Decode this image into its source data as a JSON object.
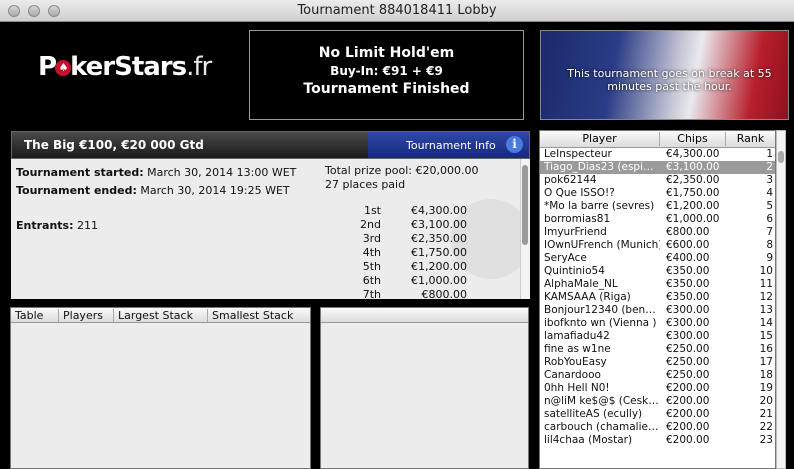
{
  "window": {
    "title": "Tournament 884018411 Lobby"
  },
  "logo": {
    "text_a": "P",
    "text_b": "kerStars",
    "text_c": ".fr"
  },
  "info": {
    "game": "No Limit Hold'em",
    "buyin": "Buy-In: €91 + €9",
    "status": "Tournament Finished"
  },
  "banner": {
    "message": "This tournament goes on break at 55 minutes past the hour."
  },
  "header": {
    "tournament_name": "The Big €100, €20 000 Gtd",
    "tab_label": "Tournament Info",
    "info_glyph": "i"
  },
  "details": {
    "started_label": "Tournament started:",
    "started_value": "March 30, 2014 13:00 WET",
    "ended_label": "Tournament ended:",
    "ended_value": "March 30, 2014 19:25 WET",
    "entrants_label": "Entrants:",
    "entrants_value": "211",
    "prize_pool": "Total prize pool: €20,000.00",
    "places_paid": "27 places paid",
    "payouts": [
      {
        "place": "1st",
        "amount": "€4,300.00"
      },
      {
        "place": "2nd",
        "amount": "€3,100.00"
      },
      {
        "place": "3rd",
        "amount": "€2,350.00"
      },
      {
        "place": "4th",
        "amount": "€1,750.00"
      },
      {
        "place": "5th",
        "amount": "€1,200.00"
      },
      {
        "place": "6th",
        "amount": "€1,000.00"
      },
      {
        "place": "7th",
        "amount": "€800.00"
      }
    ]
  },
  "tables": {
    "columns": [
      "Table",
      "Players",
      "Largest Stack",
      "Smallest Stack"
    ]
  },
  "players": {
    "columns": [
      "Player",
      "Chips",
      "Rank"
    ],
    "rows": [
      {
        "name": "LeInspecteur",
        "chips": "€4,300.00",
        "rank": "1"
      },
      {
        "name": "Tiago_Dias23 (espi…",
        "chips": "€3,100.00",
        "rank": "2"
      },
      {
        "name": "pok62144",
        "chips": "€2,350.00",
        "rank": "3"
      },
      {
        "name": "O Que ISSO!?",
        "chips": "€1,750.00",
        "rank": "4"
      },
      {
        "name": "*Mo la barre (sevres)",
        "chips": "€1,200.00",
        "rank": "5"
      },
      {
        "name": "borromias81",
        "chips": "€1,000.00",
        "rank": "6"
      },
      {
        "name": "ImyurFriend",
        "chips": "€800.00",
        "rank": "7"
      },
      {
        "name": "IOwnUFrench (Munich)",
        "chips": "€600.00",
        "rank": "8"
      },
      {
        "name": "SeryAce",
        "chips": "€400.00",
        "rank": "9"
      },
      {
        "name": "Quintinio54",
        "chips": "€350.00",
        "rank": "10"
      },
      {
        "name": "AlphaMale_NL",
        "chips": "€350.00",
        "rank": "11"
      },
      {
        "name": "KAMSAAA (Riga)",
        "chips": "€350.00",
        "rank": "12"
      },
      {
        "name": "Bonjour12340 (ben…",
        "chips": "€300.00",
        "rank": "13"
      },
      {
        "name": "ibofknto wn (Vienna )",
        "chips": "€300.00",
        "rank": "14"
      },
      {
        "name": "lamafiadu42",
        "chips": "€300.00",
        "rank": "15"
      },
      {
        "name": "fine as w1ne",
        "chips": "€250.00",
        "rank": "16"
      },
      {
        "name": "RobYouEasy",
        "chips": "€250.00",
        "rank": "17"
      },
      {
        "name": "Canardooo",
        "chips": "€250.00",
        "rank": "18"
      },
      {
        "name": "0hh Hell N0!",
        "chips": "€200.00",
        "rank": "19"
      },
      {
        "name": "n@liM ke$@$ (Cesk…",
        "chips": "€200.00",
        "rank": "20"
      },
      {
        "name": "satelliteAS (ecully)",
        "chips": "€200.00",
        "rank": "21"
      },
      {
        "name": "carbouch (chamalie…",
        "chips": "€200.00",
        "rank": "22"
      },
      {
        "name": "lil4chaa (Mostar)",
        "chips": "€200.00",
        "rank": "23"
      }
    ],
    "selected_index": 1
  }
}
